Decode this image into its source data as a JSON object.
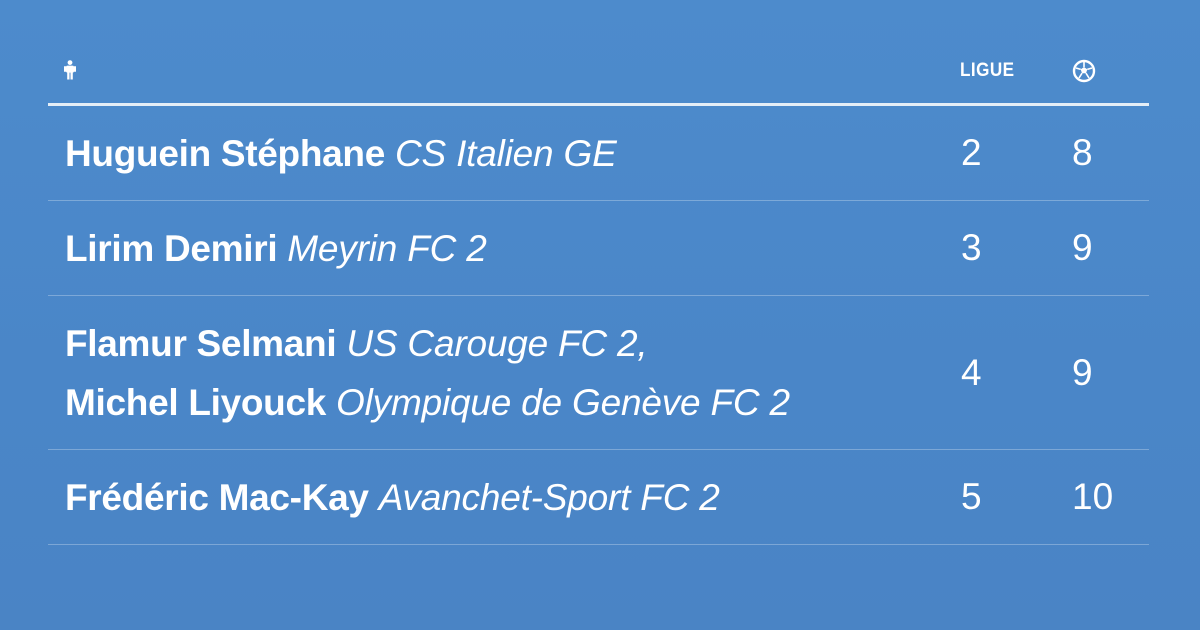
{
  "header": {
    "player_icon": "person-icon",
    "ligue_label": "LIGUE",
    "goals_icon": "soccer-ball-icon"
  },
  "rows": [
    {
      "players": [
        {
          "name": "Huguein Stéphane",
          "club": "CS Italien GE"
        }
      ],
      "ligue": "2",
      "goals": "8"
    },
    {
      "players": [
        {
          "name": "Lirim Demiri",
          "club": "Meyrin FC 2"
        }
      ],
      "ligue": "3",
      "goals": "9"
    },
    {
      "players": [
        {
          "name": "Flamur Selmani",
          "club": "US Carouge FC 2,"
        },
        {
          "name": "Michel Liyouck",
          "club": "Olympique de Genève FC 2"
        }
      ],
      "ligue": "4",
      "goals": "9"
    },
    {
      "players": [
        {
          "name": "Frédéric Mac-Kay",
          "club": "Avanchet-Sport FC 2"
        }
      ],
      "ligue": "5",
      "goals": "10"
    }
  ],
  "colors": {
    "background": "#4a87c9",
    "text": "#ffffff"
  }
}
